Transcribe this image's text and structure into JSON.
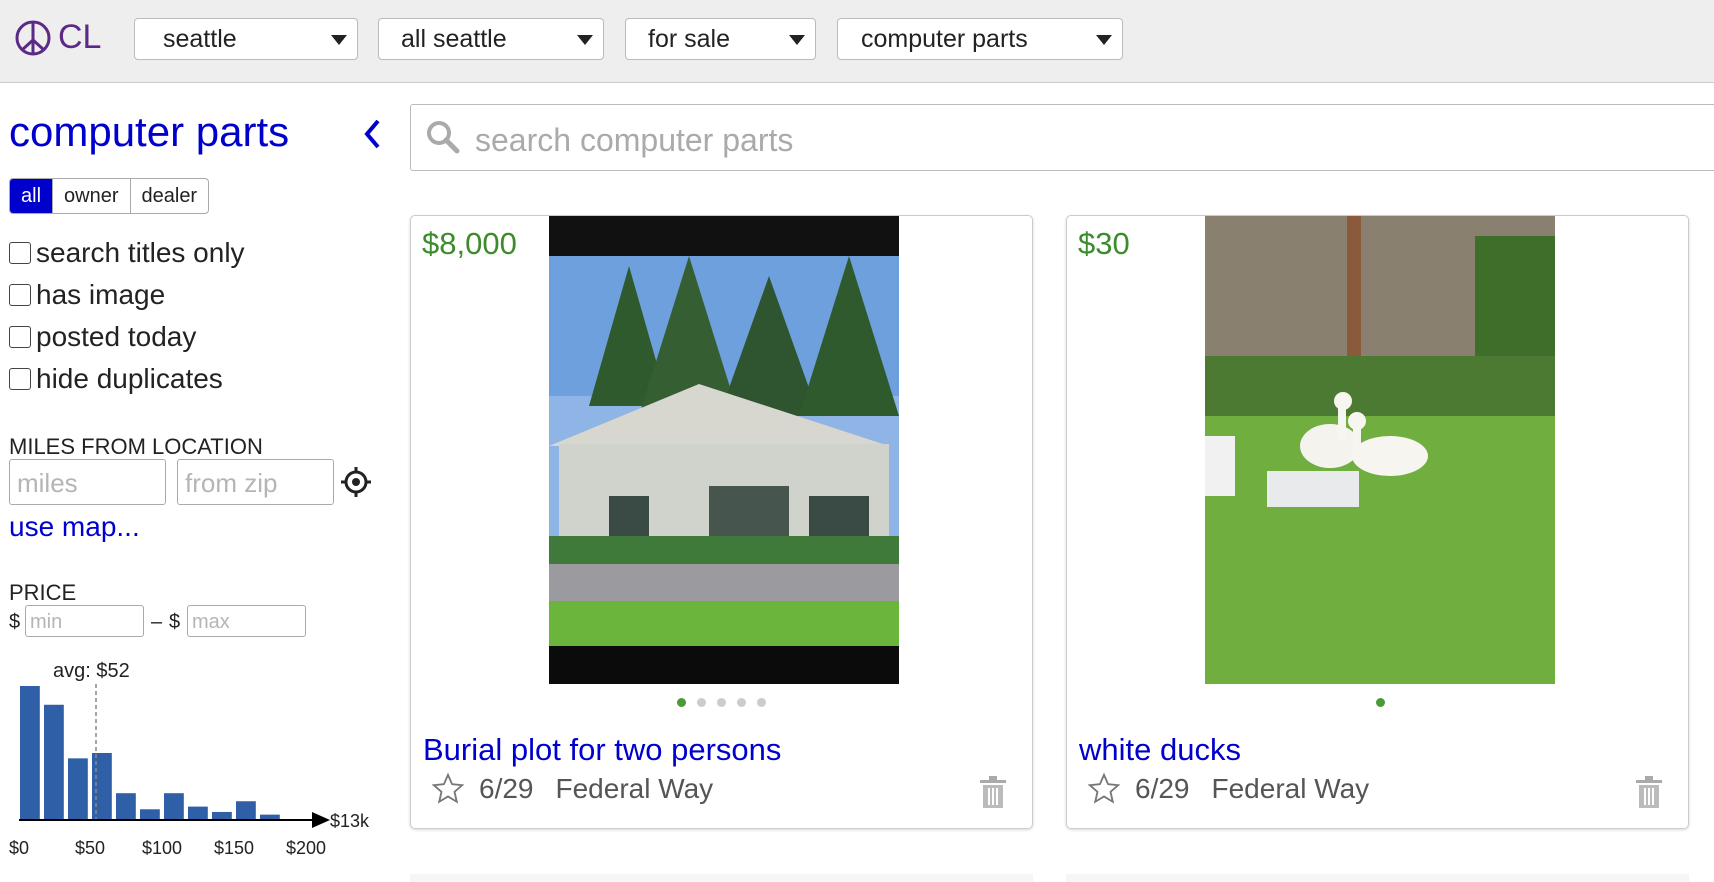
{
  "header": {
    "logo_text": "CL",
    "selects": [
      "seattle",
      "all seattle",
      "for sale",
      "computer parts"
    ]
  },
  "sidebar": {
    "title": "computer parts",
    "segments": [
      "all",
      "owner",
      "dealer"
    ],
    "checkboxes": [
      "search titles only",
      "has image",
      "posted today",
      "hide duplicates"
    ],
    "miles_label": "MILES FROM LOCATION",
    "miles_placeholder": "miles",
    "zip_placeholder": "from zip",
    "use_map": "use map...",
    "price_label": "PRICE",
    "currency": "$",
    "dash": "–",
    "min_placeholder": "min",
    "max_placeholder": "max"
  },
  "histogram": {
    "avg_label": "avg: $52",
    "end_label": "$13k",
    "ticks": [
      "$0",
      "$50",
      "$100",
      "$150",
      "$200"
    ],
    "bar_values": [
      1.0,
      0.86,
      0.46,
      0.5,
      0.2,
      0.08,
      0.2,
      0.1,
      0.06,
      0.14,
      0.04
    ]
  },
  "search": {
    "placeholder": "search computer parts"
  },
  "listings": [
    {
      "price": "$8,000",
      "title": "Burial plot for two persons",
      "date": "6/29",
      "location": "Federal Way",
      "dots": 5
    },
    {
      "price": "$30",
      "title": "white ducks",
      "date": "6/29",
      "location": "Federal Way",
      "dots": 1
    }
  ],
  "colors": {
    "link": "#0000cc",
    "price": "#3c8c2c",
    "brand": "#5b2a86",
    "bar": "#2f5fa6"
  }
}
